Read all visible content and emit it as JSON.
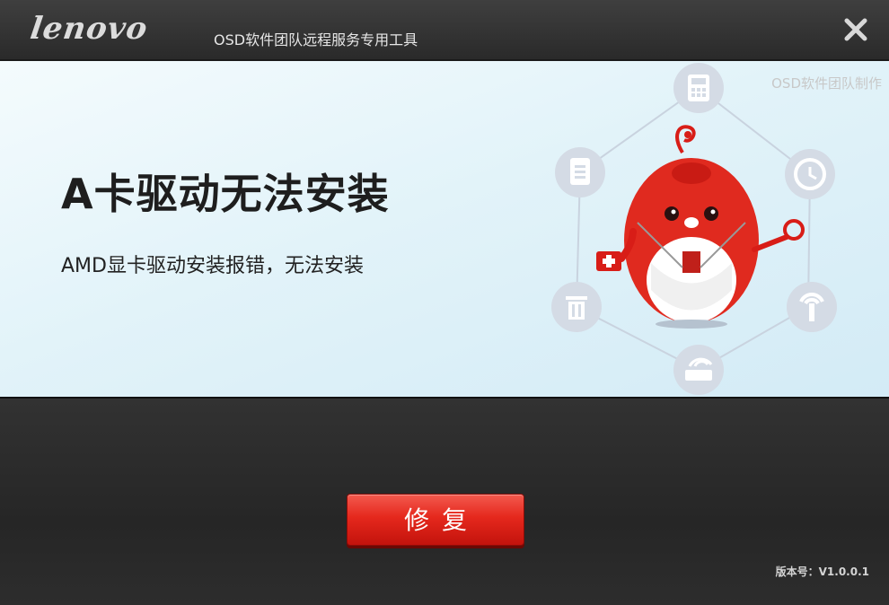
{
  "titlebar": {
    "logo_text": "lenovo",
    "subtitle": "OSD软件团队远程服务专用工具",
    "close_glyph": "✕"
  },
  "panel": {
    "credit": "OSD软件团队制作",
    "headline": "A卡驱动无法安装",
    "description": "AMD显卡驱动安装报错，无法安装"
  },
  "actions": {
    "repair_label": "修复"
  },
  "footer": {
    "version": "版本号：V1.0.0.1"
  },
  "colors": {
    "accent_red": "#e5281d",
    "titlebar_bg": "#2f2f2f",
    "panel_bg": "#e2f3f9",
    "icon_circle": "#d5dce6"
  },
  "illustration": {
    "icons": [
      "calculator-icon",
      "clock-icon",
      "signal-icon",
      "router-icon",
      "trash-icon",
      "clipboard-icon"
    ],
    "mascot": "red-mascot-with-medkit-and-magnifier"
  }
}
